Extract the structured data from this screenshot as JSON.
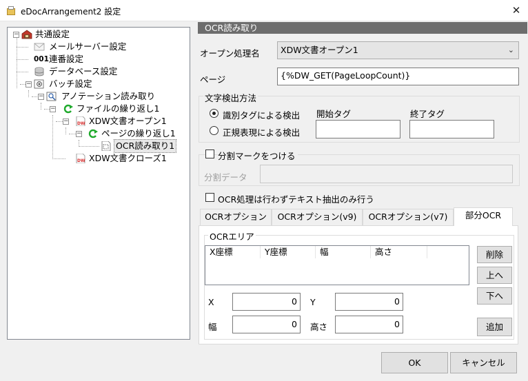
{
  "window": {
    "title": "eDocArrangement2 設定",
    "close_glyph": "✕"
  },
  "tree": {
    "shared": {
      "label": "共通設定",
      "icon": "house-box-icon"
    },
    "mail": {
      "label": "メールサーバー設定",
      "icon": "mail-icon"
    },
    "serial_prefix": "001",
    "serial": {
      "label": "連番設定"
    },
    "database": {
      "label": "データベース設定",
      "icon": "database-icon"
    },
    "batch": {
      "label": "バッチ設定",
      "icon": "batch-gear-icon"
    },
    "annotation": {
      "label": "アノテーション読み取り",
      "icon": "annotation-icon"
    },
    "file_loop": {
      "label": "ファイルの繰り返し1",
      "icon": "loop-arrow-icon"
    },
    "xdw_open": {
      "label": "XDW文書オープン1",
      "icon": "xdw-document-icon",
      "badge": "DW"
    },
    "page_loop": {
      "label": "ページの繰り返し1",
      "icon": "loop-arrow-icon"
    },
    "ocr_read": {
      "label": "OCR読み取り1",
      "icon": "ocr-document-icon"
    },
    "xdw_close": {
      "label": "XDW文書クローズ1",
      "icon": "xdw-document-icon",
      "badge": "DW"
    }
  },
  "panel": {
    "header": "OCR読み取り",
    "open_process": {
      "label": "オープン処理名",
      "value": "XDW文書オープン1"
    },
    "page": {
      "label": "ページ",
      "value": "{%DW_GET(PageLoopCount)}"
    },
    "detection": {
      "label": "文字検出方法",
      "radio_tag": "識別タグによる検出",
      "radio_regex": "正規表現による検出",
      "start_tag": "開始タグ",
      "end_tag": "終了タグ",
      "start_value": "",
      "end_value": ""
    },
    "split_mark": {
      "label": "分割マークをつける",
      "data_label": "分割データ",
      "data_value": ""
    },
    "text_only": {
      "label": "OCR処理は行わずテキスト抽出のみ行う"
    },
    "tabs": [
      "OCRオプション",
      "OCRオプション(v9)",
      "OCRオプション(v7)",
      "部分OCR"
    ],
    "ocr_area": {
      "group_label": "OCRエリア",
      "columns": [
        "X座標",
        "Y座標",
        "幅",
        "高さ"
      ],
      "delete_btn": "削除",
      "up_btn": "上へ",
      "down_btn": "下へ",
      "add_btn": "追加",
      "x_label": "X",
      "y_label": "Y",
      "w_label": "幅",
      "h_label": "高さ",
      "x_value": "0",
      "y_value": "0",
      "w_value": "0",
      "h_value": "0"
    }
  },
  "footer": {
    "ok": "OK",
    "cancel": "キャンセル"
  },
  "colors": {
    "header_bg": "#6d6d6d",
    "window_bg": "#f0f0f0",
    "accent_loop": "#1faa2c",
    "xdw_red": "#d62a2a"
  }
}
